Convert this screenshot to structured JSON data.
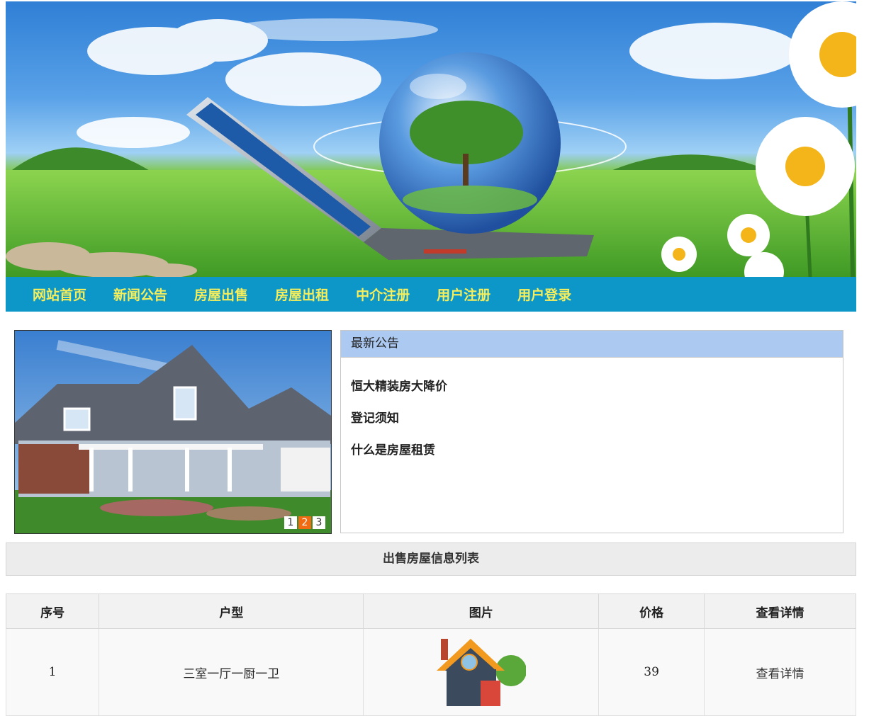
{
  "nav": {
    "items": [
      "网站首页",
      "新闻公告",
      "房屋出售",
      "房屋出租",
      "中介注册",
      "用户注册",
      "用户登录"
    ]
  },
  "slider": {
    "pages": [
      "1",
      "2",
      "3"
    ],
    "active_index": 1
  },
  "notice": {
    "title": "最新公告",
    "items": [
      "恒大精装房大降价",
      "登记须知",
      "什么是房屋租赁"
    ]
  },
  "list": {
    "title": "出售房屋信息列表",
    "columns": [
      "序号",
      "户型",
      "图片",
      "价格",
      "查看详情"
    ],
    "rows": [
      {
        "index": "1",
        "type": "三室一厅一厨一卫",
        "price": "39",
        "detail": "查看详情"
      }
    ]
  },
  "colors": {
    "nav_bg": "#0d96c8",
    "nav_text": "#f6ee5a",
    "notice_head": "#acc9f2",
    "active_dot": "#f06b12"
  }
}
